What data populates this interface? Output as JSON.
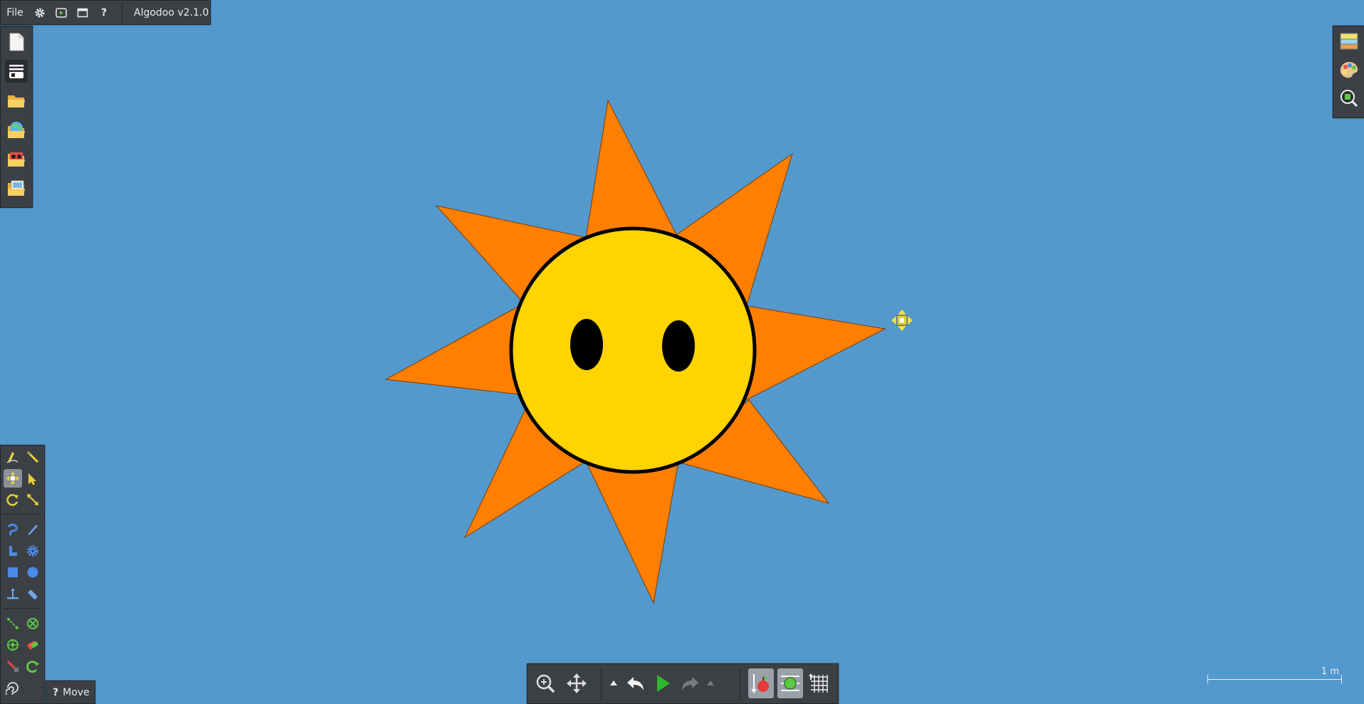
{
  "menu": {
    "file_label": "File",
    "icons": [
      "gear-icon",
      "play-scene-icon",
      "window-icon",
      "help-icon"
    ],
    "help_glyph": "?",
    "version": "Algodoo v2.1.0"
  },
  "file_toolbar": [
    "new-scene-icon",
    "toolbar-icon",
    "open-folder-icon",
    "browse-online-icon",
    "load-phunlet-icon",
    "open-image-icon"
  ],
  "right_toolbar": [
    "background-icon",
    "appearance-palette-icon",
    "zoom-object-icon"
  ],
  "tools": {
    "selected": "move-tool",
    "items": [
      "sketch-tool",
      "cut-tool",
      "move-tool",
      "drag-tool",
      "rotate-tool",
      "scale-tool",
      "rope-tool",
      "knife-tool",
      "brush-tool",
      "gear-tool",
      "box-tool",
      "circle-tool",
      "plane-tool",
      "spring-tool",
      "chain-tool",
      "fixate-tool",
      "axle-tool",
      "thruster-tool",
      "laser-tool",
      "tracer-tool",
      "water-tool"
    ]
  },
  "tooltip": {
    "glyph": "?",
    "text": "Move"
  },
  "bottom_toolbar": {
    "items": [
      "zoom-icon",
      "pan-icon",
      "undo-menu-arrow-icon",
      "undo-icon",
      "play-icon",
      "redo-icon",
      "redo-menu-arrow-icon",
      "gravity-toggle-icon",
      "air-friction-toggle-icon",
      "grid-toggle-icon"
    ]
  },
  "scale_bar": {
    "label": "1 m"
  },
  "colors": {
    "background": "#5499cd",
    "sun_body": "#ffd400",
    "sun_rays": "#ff7f00",
    "panel": "#3c4045"
  }
}
